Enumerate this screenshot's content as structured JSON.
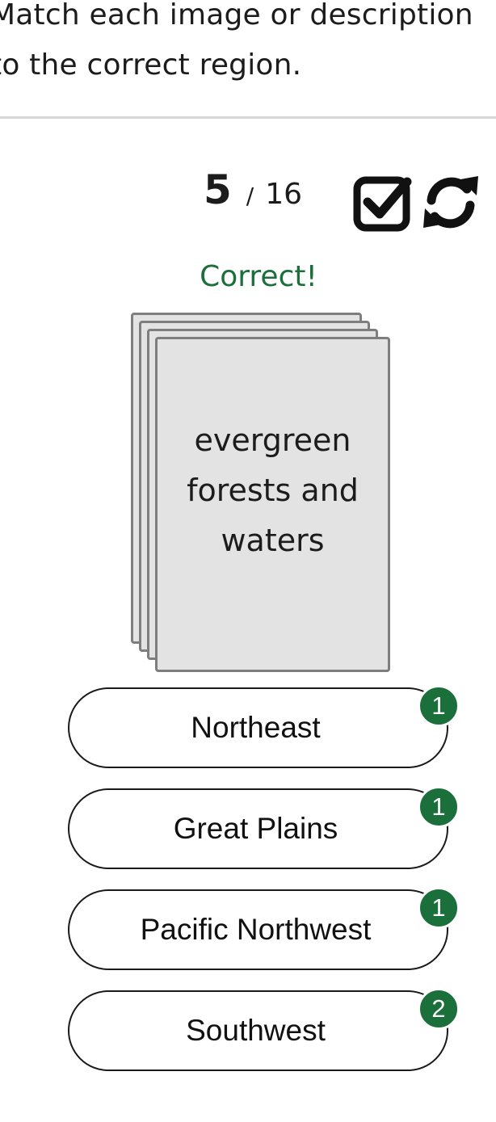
{
  "instructions": "Match each image or description to the correct region.",
  "progress": {
    "current": "5",
    "separator": "/",
    "total": "16"
  },
  "toolbar": {
    "check_icon": "check-square-icon",
    "refresh_icon": "refresh-icon"
  },
  "feedback": {
    "text": "Correct!",
    "color": "#1b6f3a"
  },
  "card": {
    "text": "evergreen forests and waters"
  },
  "options": [
    {
      "label": "Northeast",
      "count": "1"
    },
    {
      "label": "Great Plains",
      "count": "1"
    },
    {
      "label": "Pacific Northwest",
      "count": "1"
    },
    {
      "label": "Southwest",
      "count": "2"
    }
  ],
  "colors": {
    "accent": "#1b6f3a",
    "card_bg": "#e3e3e3",
    "card_border": "#7e7e7e"
  }
}
